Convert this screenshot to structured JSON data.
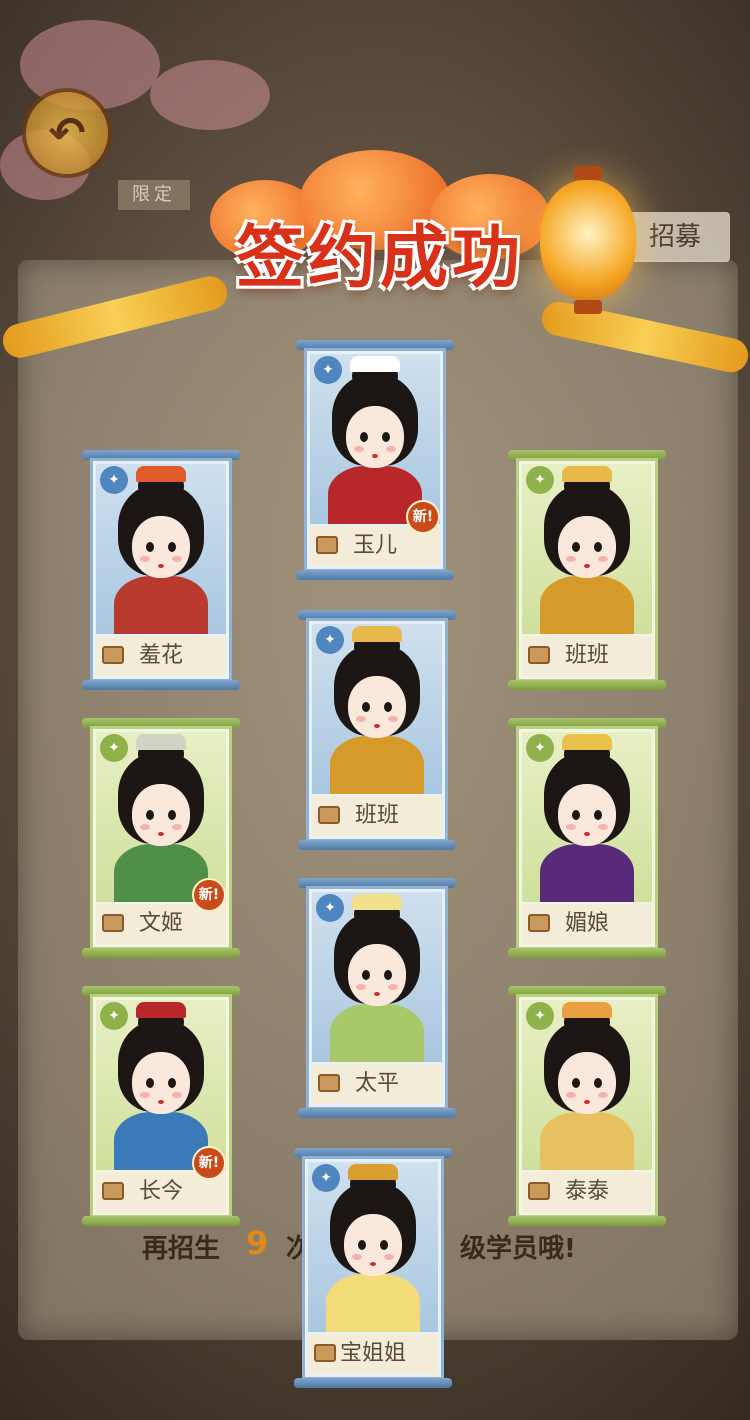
{
  "title": "签约成功",
  "header": {
    "limited_tag": "限定",
    "recruit_tab": "招募"
  },
  "footer": {
    "text_before": "再招生",
    "count": "9",
    "text_mid": "次",
    "text_after": "级学员哦!"
  },
  "cards": [
    {
      "id": "yuer",
      "name": "玉儿",
      "frame": "blue",
      "class_icon": "ruler-icon",
      "is_new": true,
      "robe": "#b8282a",
      "accent": "#ffffff"
    },
    {
      "id": "xiuhua",
      "name": "羞花",
      "frame": "blue",
      "class_icon": "pendant-icon",
      "is_new": false,
      "robe": "#b83a2e",
      "accent": "#e05a2a"
    },
    {
      "id": "banban1",
      "name": "班班",
      "frame": "green",
      "class_icon": "pouch-icon",
      "is_new": false,
      "robe": "#d69a2a",
      "accent": "#e8b84a"
    },
    {
      "id": "banban2",
      "name": "班班",
      "frame": "blue",
      "class_icon": "pouch-icon",
      "is_new": false,
      "robe": "#d69a2a",
      "accent": "#e8b84a"
    },
    {
      "id": "wenji",
      "name": "文姬",
      "frame": "green",
      "class_icon": "pouch-icon",
      "is_new": true,
      "robe": "#4f8f4a",
      "accent": "#cfd4c4"
    },
    {
      "id": "meiniang",
      "name": "媚娘",
      "frame": "green",
      "class_icon": "ruler-icon",
      "is_new": false,
      "robe": "#5a2a7a",
      "accent": "#e8c04a"
    },
    {
      "id": "taiping",
      "name": "太平",
      "frame": "blue",
      "class_icon": "ruler-icon",
      "is_new": false,
      "robe": "#a8c86a",
      "accent": "#f2e08a"
    },
    {
      "id": "changjin",
      "name": "长今",
      "frame": "green",
      "class_icon": "pendant-icon",
      "is_new": true,
      "robe": "#3a7ab8",
      "accent": "#b8282a"
    },
    {
      "id": "taitai",
      "name": "泰泰",
      "frame": "green",
      "class_icon": "ruler-icon",
      "is_new": false,
      "robe": "#e8c060",
      "accent": "#e8a040"
    },
    {
      "id": "baojiejie",
      "name": "宝姐姐",
      "frame": "blue",
      "class_icon": "pendant-icon",
      "is_new": false,
      "robe": "#f2dc7a",
      "accent": "#d8a030"
    }
  ],
  "labels": {
    "new_badge": "新!"
  }
}
